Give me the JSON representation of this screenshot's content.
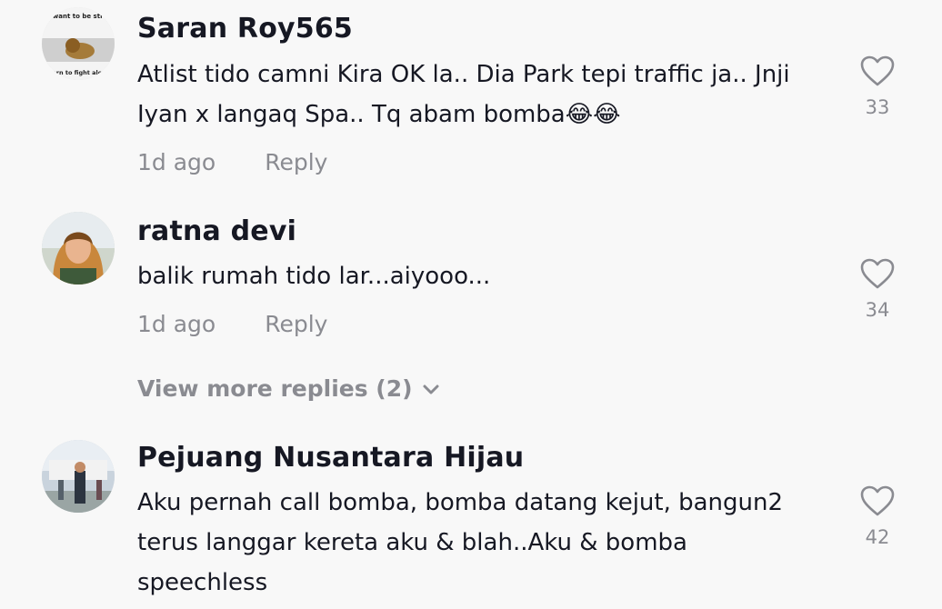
{
  "comments": [
    {
      "username": "Saran Roy565",
      "text": "Atlist tido camni Kira OK la.. Dia Park tepi traffic ja.. Jnji Iyan x langaq Spa.. Tq abam bomba😂😂",
      "time": "1d ago",
      "reply_label": "Reply",
      "likes": "33",
      "avatar_text_top": "you want to be strong,",
      "avatar_text_bottom": "learn to fight alone"
    },
    {
      "username": "ratna devi",
      "text": "balik rumah tido lar...aiyooo...",
      "time": "1d ago",
      "reply_label": "Reply",
      "likes": "34",
      "view_more_label": "View more replies (2)"
    },
    {
      "username": "Pejuang Nusantara Hijau",
      "text": "Aku pernah call bomba, bomba datang kejut, bangun2 terus langgar kereta aku & blah..Aku & bomba speechless",
      "likes": "42"
    }
  ],
  "icons": {
    "like": "heart-outline-icon",
    "expand": "chevron-down-icon"
  },
  "colors": {
    "background": "#f8f8f8",
    "primary_text": "#161823",
    "secondary_text": "#8a8b91"
  }
}
